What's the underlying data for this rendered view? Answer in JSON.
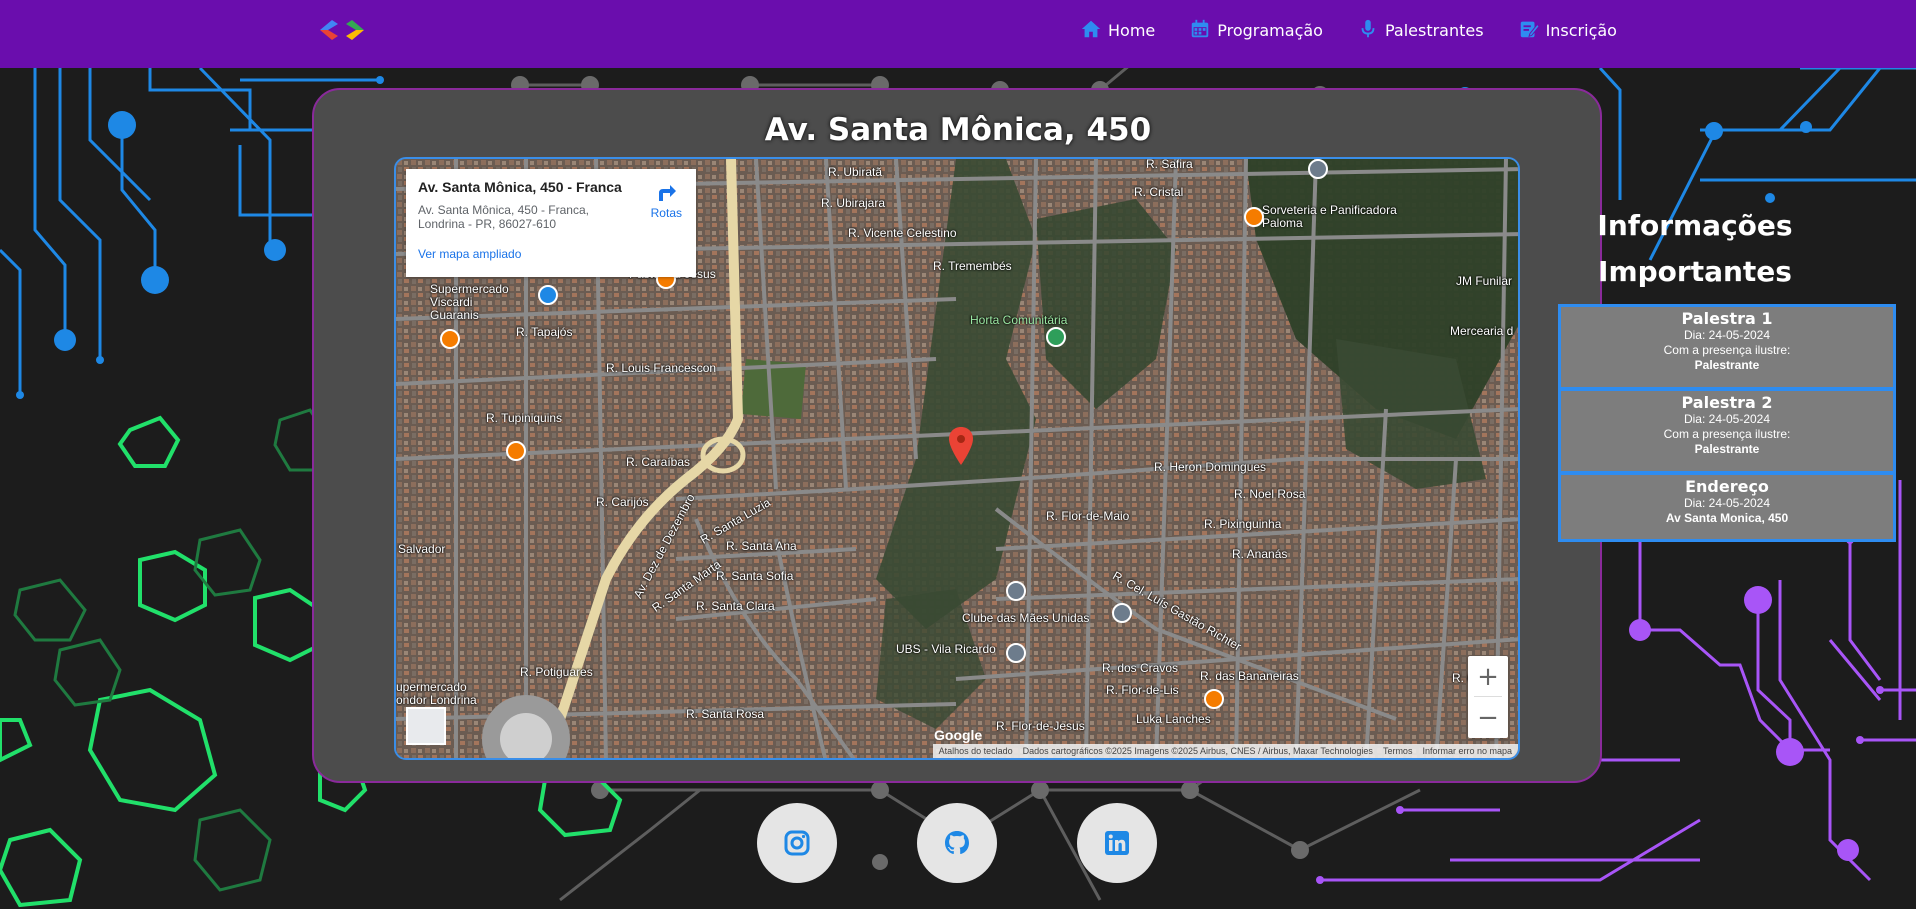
{
  "header": {
    "nav": [
      {
        "label": "Home",
        "icon": "home-icon"
      },
      {
        "label": "Programação",
        "icon": "calendar-icon"
      },
      {
        "label": "Palestrantes",
        "icon": "microphone-icon"
      },
      {
        "label": "Inscrição",
        "icon": "edit-icon"
      }
    ]
  },
  "main": {
    "title": "Av. Santa Mônica, 450"
  },
  "map": {
    "card_title": "Av. Santa Mônica, 450 - Franca",
    "card_address": "Av. Santa Mônica, 450 - Franca, Londrina - PR, 86027-610",
    "directions_label": "Rotas",
    "larger_map_label": "Ver mapa ampliado",
    "zoom_in": "+",
    "zoom_out": "−",
    "brand": "Google",
    "attribution": {
      "shortcuts": "Atalhos do teclado",
      "data": "Dados cartográficos ©2025 Imagens ©2025 Airbus, CNES / Airbus, Maxar Technologies",
      "terms": "Termos",
      "report": "Informar erro no mapa"
    },
    "labels": [
      "R. Ubiratã",
      "R. Ubirajara",
      "R. Vicente Celestino",
      "R. Tremembés",
      "Pastel Du Jesus",
      "Supermercado Viscardi Guaranis",
      "R. Tapajós",
      "R. Louis Francescon",
      "R. Tupiniquins",
      "R. Caraíbas",
      "R. Carijós",
      "Horta Comunitária",
      "R. Heron Domingues",
      "R. Noel Rosa",
      "R. Pixinguinha",
      "R. Ananás",
      "R. Flor-de-Maio",
      "R. Santa Ana",
      "R. Santa Sofia",
      "R. Santa Clara",
      "Clube das Mães Unidas",
      "UBS - Vila Ricardo",
      "R. Potiguares",
      "R. dos Cravos",
      "R. Flor-de-Lis",
      "Luka Lanches",
      "R. das Bananeiras",
      "Sorveteria e Panificadora Paloma",
      "JM Funilar",
      "Mercearia d",
      "R. Santa Rosa",
      "R. Cel. Luís Gastão Richter",
      "R. Flor-de-Jesus",
      "Salvador",
      "upermercado ondor Londrina",
      "R. Cristal",
      "R. Safira",
      "Av. Dez de Dezembro",
      "R. Santa Luzia",
      "R. Santa Marta",
      "R. Cel. Lu"
    ]
  },
  "info": {
    "title": "Informações Importantes",
    "boxes": [
      {
        "title": "Palestra 1",
        "date": "Dia: 24-05-2024",
        "line": "Com a presença ilustre:",
        "bold": "Palestrante"
      },
      {
        "title": "Palestra 2",
        "date": "Dia: 24-05-2024",
        "line": "Com a presença ilustre:",
        "bold": "Palestrante"
      },
      {
        "title": "Endereço",
        "date": "Dia: 24-05-2024",
        "bold": "Av Santa Monica, 450"
      }
    ]
  },
  "social": [
    {
      "icon": "instagram-icon"
    },
    {
      "icon": "github-icon"
    },
    {
      "icon": "linkedin-icon"
    }
  ],
  "colors": {
    "header": "#6a0dad",
    "background": "#1c1c1c",
    "panel": "#4c4c4c",
    "accent_blue": "#2e8cf0",
    "circuit_purple": "#a855f7",
    "hex_green": "#22e06a"
  }
}
